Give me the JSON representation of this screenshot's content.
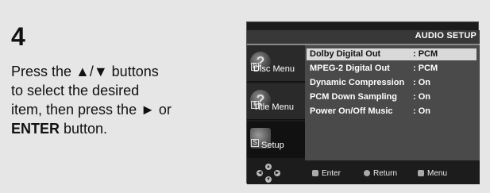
{
  "step": {
    "number": "4",
    "text_1": "Press the ▲/▼ buttons",
    "text_2": "to select the desired",
    "text_3": "item, then press the ► or",
    "text_4_bold": "ENTER",
    "text_4_rest": " button."
  },
  "osd": {
    "title": "AUDIO SETUP",
    "sidebar": [
      {
        "label": "Disc Menu",
        "icon": "disc-icon"
      },
      {
        "label": "Title Menu",
        "icon": "title-icon"
      },
      {
        "label": "Setup",
        "icon": "setup-icon"
      }
    ],
    "menu": [
      {
        "label": "Dolby Digital Out",
        "value": ": PCM"
      },
      {
        "label": "MPEG-2 Digital Out",
        "value": ": PCM"
      },
      {
        "label": "Dynamic Compression",
        "value": ": On"
      },
      {
        "label": "PCM Down Sampling",
        "value": ": On"
      },
      {
        "label": "Power On/Off Music",
        "value": ": On"
      }
    ],
    "footer": {
      "enter_label": "Enter",
      "return_label": "Return",
      "menu_label": "Menu"
    }
  }
}
